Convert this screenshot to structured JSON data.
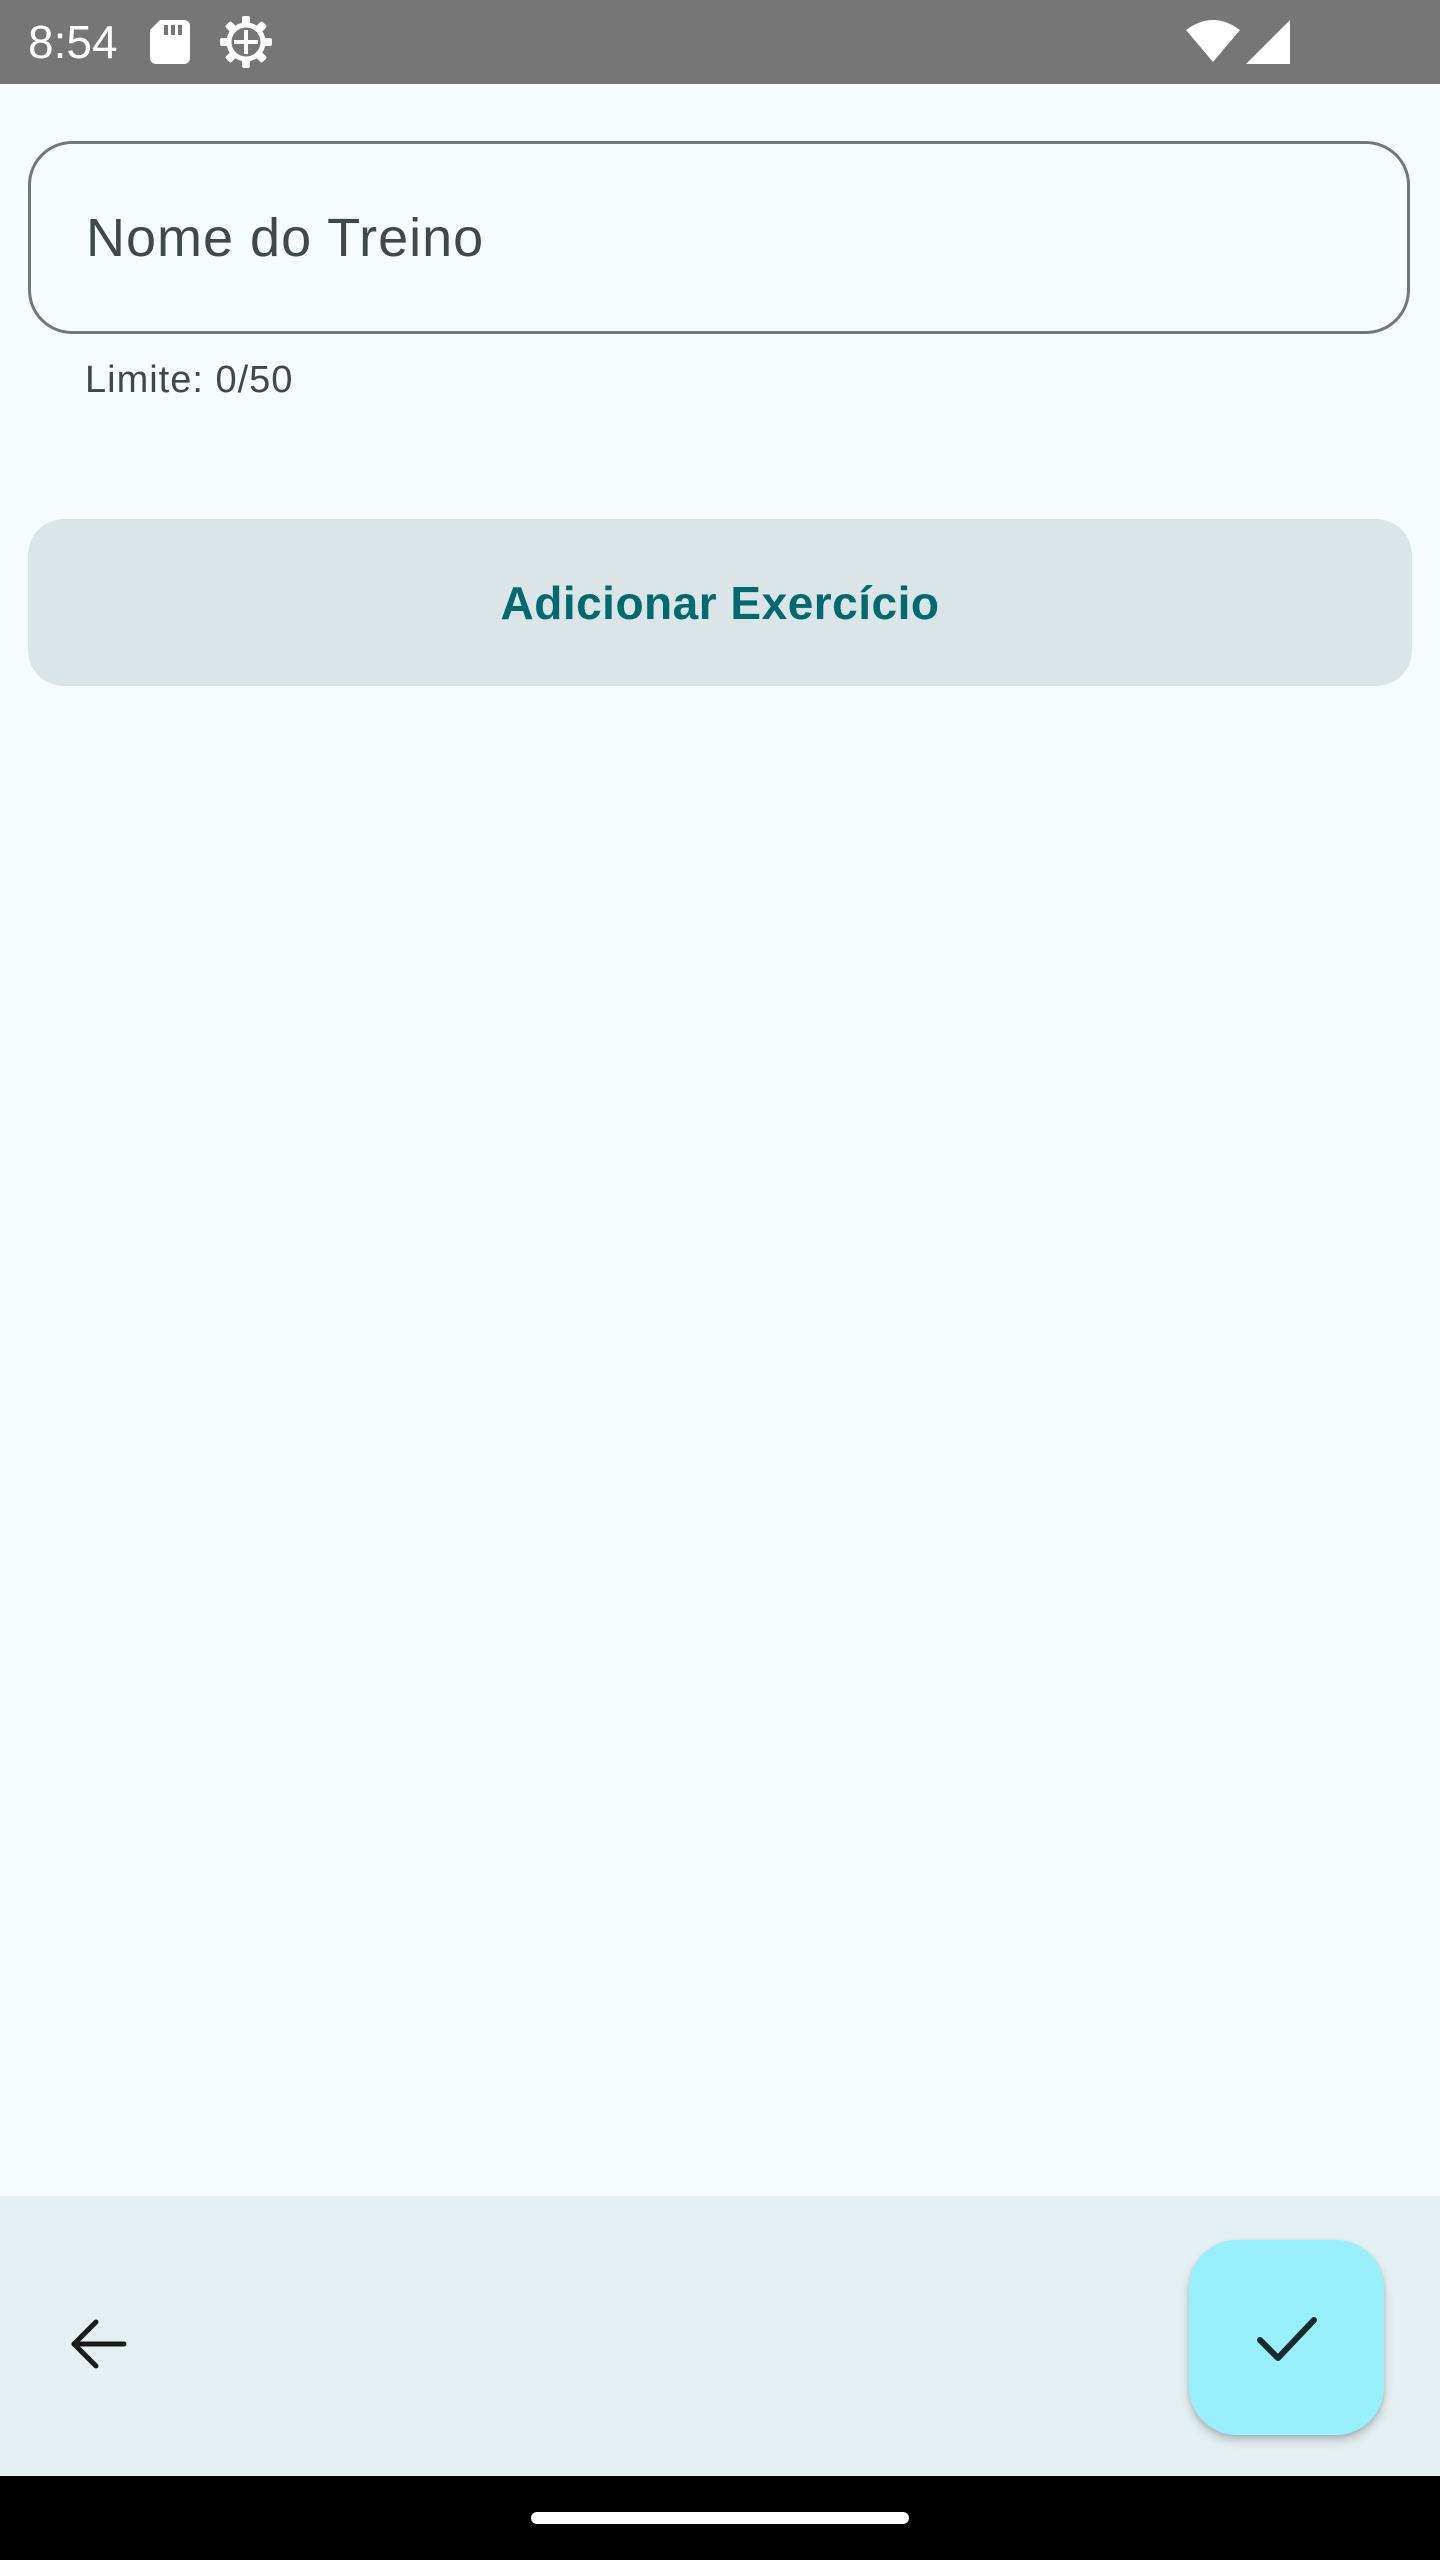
{
  "status_bar": {
    "time": "8:54",
    "icons": [
      "sd-card-icon",
      "settings-gear-icon",
      "wifi-icon",
      "cell-signal-icon"
    ]
  },
  "form": {
    "name_field": {
      "placeholder": "Nome do Treino",
      "value": ""
    },
    "helper_text": "Limite: 0/50"
  },
  "actions": {
    "add_exercise_label": "Adicionar Exercício"
  },
  "bottom_bar": {
    "back_icon": "arrow-back-icon",
    "confirm_icon": "check-icon"
  },
  "colors": {
    "background": "#f6fbfd",
    "status_bar": "#767676",
    "outline": "#6f7979",
    "button_bg": "#dbe4e6",
    "accent_text": "#006a70",
    "bottom_bar": "#e5f0f2",
    "fab": "#97f0fb"
  }
}
